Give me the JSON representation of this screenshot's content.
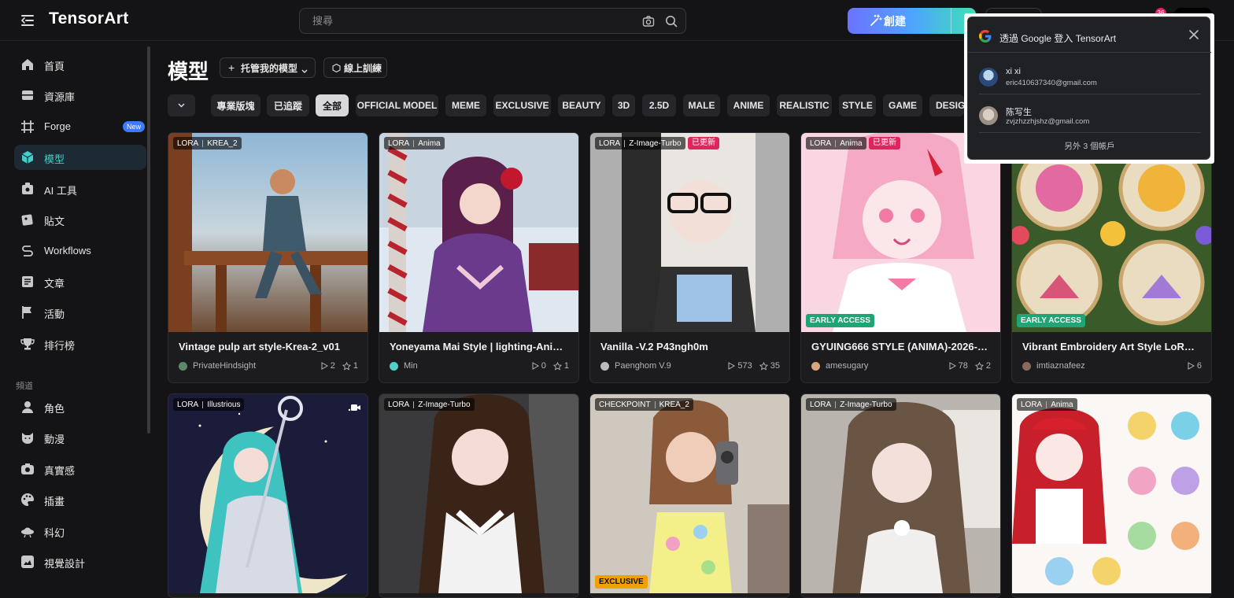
{
  "app": {
    "logo": "TensorArt"
  },
  "search": {
    "placeholder": "搜尋"
  },
  "topbar": {
    "create_label": "創建",
    "notification_count": "36"
  },
  "sidebar": {
    "items": [
      {
        "label": "首頁",
        "icon": "home-icon"
      },
      {
        "label": "資源庫",
        "icon": "library-icon"
      },
      {
        "label": "Forge",
        "icon": "forge-icon",
        "badge": "New"
      },
      {
        "label": "模型",
        "icon": "model-cube-icon",
        "active": true
      },
      {
        "label": "AI 工具",
        "icon": "ai-tools-icon"
      },
      {
        "label": "貼文",
        "icon": "posts-icon"
      },
      {
        "label": "Workflows",
        "icon": "workflow-icon"
      },
      {
        "label": "文章",
        "icon": "article-icon"
      },
      {
        "label": "活動",
        "icon": "flag-icon"
      },
      {
        "label": "排行榜",
        "icon": "trophy-icon"
      }
    ],
    "section_label": "頻道",
    "channels": [
      {
        "label": "角色",
        "icon": "character-icon"
      },
      {
        "label": "動漫",
        "icon": "anime-cat-icon"
      },
      {
        "label": "真實感",
        "icon": "camera-icon"
      },
      {
        "label": "插畫",
        "icon": "palette-icon"
      },
      {
        "label": "科幻",
        "icon": "ufo-icon"
      },
      {
        "label": "視覺設計",
        "icon": "design-icon"
      }
    ]
  },
  "main": {
    "title": "模型",
    "host_button": "托管我的模型",
    "train_button": "線上訓練",
    "filters": [
      "專業版塊",
      "已追蹤",
      "全部",
      "OFFICIAL MODEL",
      "MEME",
      "EXCLUSIVE",
      "BEAUTY",
      "3D",
      "2.5D",
      "MALE",
      "ANIME",
      "REALISTIC",
      "STYLE",
      "GAME",
      "DESIGN"
    ],
    "selected_filter": "全部",
    "updated_label": "已更新",
    "early_access_label": "EARLY ACCESS",
    "cards": [
      {
        "type": "LORA",
        "base": "KREA_2",
        "title": "Vintage pulp art style-Krea-2_v01",
        "author": "PrivateHindsight",
        "runs": "2",
        "stars": "1"
      },
      {
        "type": "LORA",
        "base": "Anima",
        "title": "Yoneyama Mai Style | lighting-Anim...",
        "author": "Min",
        "runs": "0",
        "stars": "1"
      },
      {
        "type": "LORA",
        "base": "Z-Image-Turbo",
        "updated": true,
        "title": "Vanilla -V.2 P43ngh0m",
        "author": "Paenghom V.9",
        "runs": "573",
        "stars": "35"
      },
      {
        "type": "LORA",
        "base": "Anima",
        "updated": true,
        "early": true,
        "title": "GYUING666 STYLE (ANIMA)-2026-0...",
        "author": "amesugary",
        "runs": "78",
        "stars": "2"
      },
      {
        "type": "",
        "base": "",
        "early": true,
        "title": "Vibrant Embroidery Art Style LoRA-...",
        "author": "imtiaznafeez",
        "runs": "6",
        "stars": ""
      },
      {
        "type": "LORA",
        "base": "Illustrious",
        "video": true
      },
      {
        "type": "LORA",
        "base": "Z-Image-Turbo"
      },
      {
        "type": "CHECKPOINT",
        "base": "KREA_2",
        "exclusive": "EXCLUSIVE"
      },
      {
        "type": "LORA",
        "base": "Z-Image-Turbo"
      },
      {
        "type": "LORA",
        "base": "Anima"
      }
    ]
  },
  "google_popup": {
    "title": "透過 Google 登入 TensorArt",
    "accounts": [
      {
        "name": "xi xi",
        "email": "eric410637340@gmail.com"
      },
      {
        "name": "陈写生",
        "email": "zvjzhzzhjshz@gmail.com"
      }
    ],
    "more": "另外 3 個帳戶"
  },
  "colors": {
    "accent": "#3fd0c9",
    "bg": "#141416",
    "update_badge": "#e0245e",
    "early_badge": "#1fa574",
    "exclusive_badge": "#f0a000"
  }
}
